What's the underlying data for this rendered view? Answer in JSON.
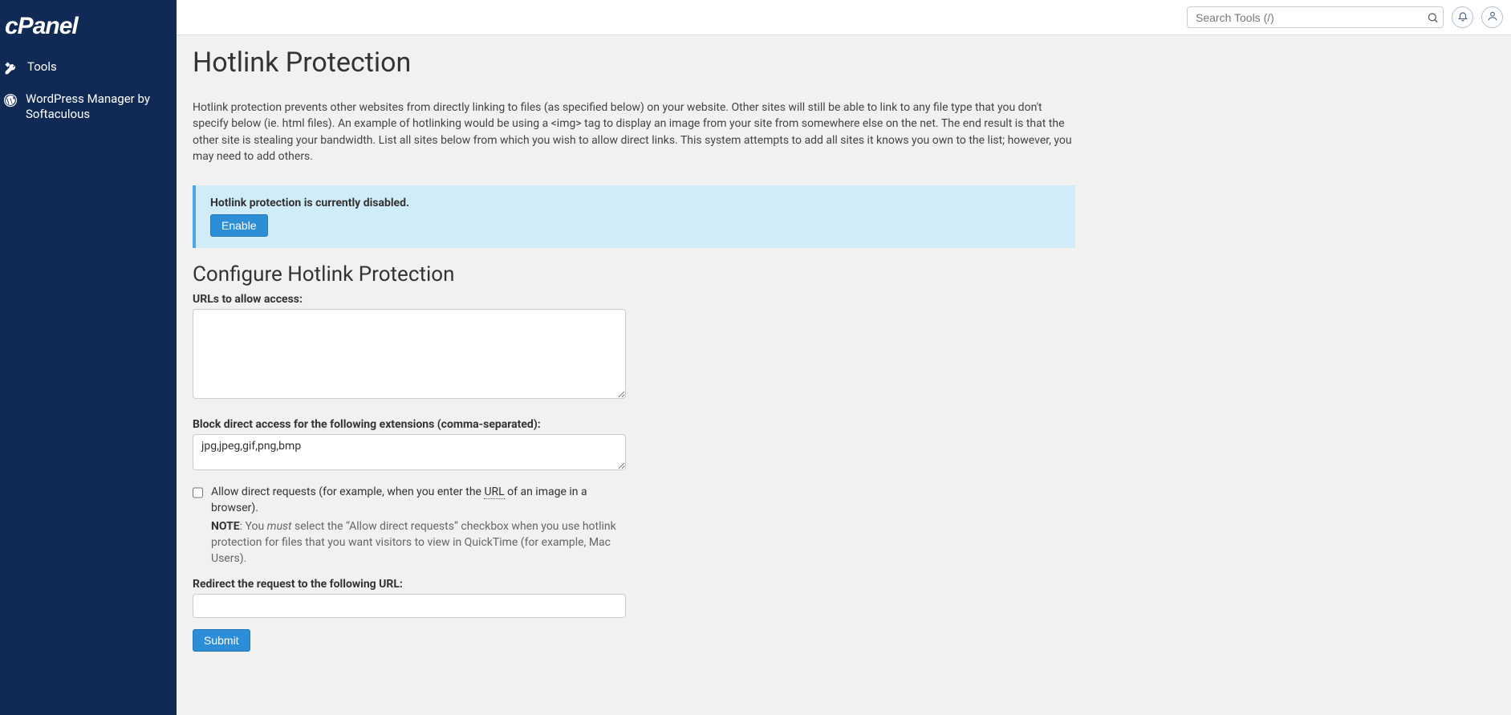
{
  "brand": "cPanel",
  "sidebar": {
    "items": [
      {
        "label": "Tools",
        "icon": "tools"
      },
      {
        "label": "WordPress Manager by Softaculous",
        "icon": "wordpress"
      }
    ]
  },
  "topbar": {
    "search_placeholder": "Search Tools (/)"
  },
  "page": {
    "title": "Hotlink Protection",
    "intro": "Hotlink protection prevents other websites from directly linking to files (as specified below) on your website. Other sites will still be able to link to any file type that you don't specify below (ie. html files). An example of hotlinking would be using a <img> tag to display an image from your site from somewhere else on the net. The end result is that the other site is stealing your bandwidth. List all sites below from which you wish to allow direct links. This system attempts to add all sites it knows you own to the list; however, you may need to add others."
  },
  "alert": {
    "message": "Hotlink protection is currently disabled.",
    "button": "Enable"
  },
  "form": {
    "heading": "Configure Hotlink Protection",
    "urls_label": "URLs to allow access:",
    "urls_value": "",
    "block_label": "Block direct access for the following extensions (comma-separated):",
    "block_value": "jpg,jpeg,gif,png,bmp",
    "allow_direct_label_pre": "Allow direct requests (for example, when you enter the ",
    "allow_direct_url_abbr": "URL",
    "allow_direct_label_post": " of an image in a browser).",
    "note_label": "NOTE",
    "note_pre": ": You ",
    "note_must": "must",
    "note_post": " select the “Allow direct requests” checkbox when you use hotlink protection for files that you want visitors to view in QuickTime (for example, Mac Users).",
    "redirect_label": "Redirect the request to the following URL:",
    "redirect_value": "",
    "submit": "Submit"
  }
}
